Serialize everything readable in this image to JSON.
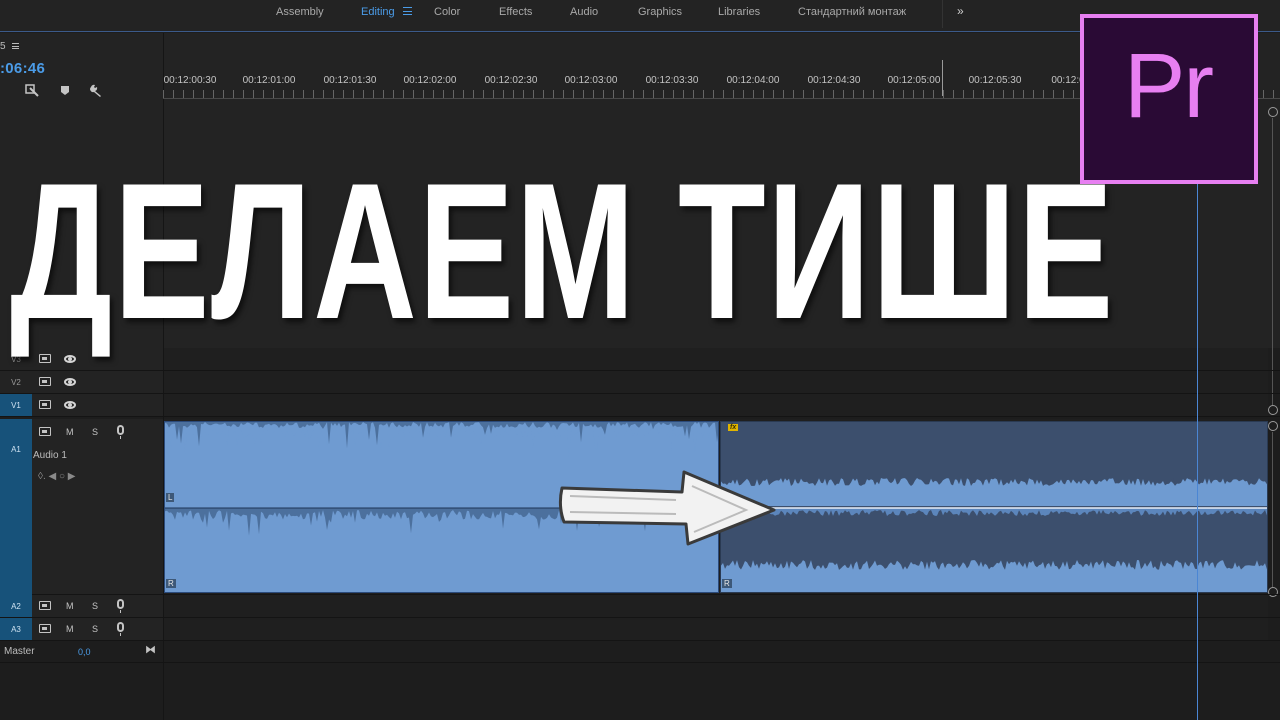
{
  "workspace_tabs": [
    {
      "label": "Assembly",
      "active": false
    },
    {
      "label": "Editing",
      "active": true
    },
    {
      "label": "Color",
      "active": false
    },
    {
      "label": "Effects",
      "active": false
    },
    {
      "label": "Audio",
      "active": false
    },
    {
      "label": "Graphics",
      "active": false
    },
    {
      "label": "Libraries",
      "active": false
    },
    {
      "label": "Стандартний монтаж",
      "active": false
    }
  ],
  "workspace_more": "»",
  "sequence": {
    "name_fragment": "5",
    "timecode": ":06:46"
  },
  "ruler_labels": [
    "00:12:00:30",
    "00:12:01:00",
    "00:12:01:30",
    "00:12:02:00",
    "00:12:02:30",
    "00:12:03:00",
    "00:12:03:30",
    "00:12:04:00",
    "00:12:04:30",
    "00:12:05:00",
    "00:12:05:30",
    "00:12:0"
  ],
  "tracks": {
    "v3": {
      "id": "V3"
    },
    "v2": {
      "id": "V2"
    },
    "v1": {
      "id": "V1",
      "selected": true
    },
    "a1": {
      "id": "A1",
      "name": "Audio 1",
      "mute": "M",
      "solo": "S",
      "keyframe": "◊.   ◀   ○   ▶"
    },
    "a2": {
      "id": "A2",
      "mute": "M",
      "solo": "S"
    },
    "a3": {
      "id": "A3",
      "mute": "M",
      "solo": "S"
    }
  },
  "clip": {
    "left_channel": "L",
    "right_channel": "R",
    "fx_badge": "fx"
  },
  "master": {
    "label": "Master",
    "value": "0,0",
    "icon": "⧓"
  },
  "headline": "ДЕЛАЕМ ТИШЕ",
  "logo": {
    "text": "Pr",
    "border_color": "#e77ff1",
    "bg_color": "#2a0a35"
  },
  "colors": {
    "accent": "#4b9ce8",
    "clip_loud": "#6f9bd1",
    "clip_quiet": "#3c4f6d",
    "playhead": "#4b86d4"
  }
}
